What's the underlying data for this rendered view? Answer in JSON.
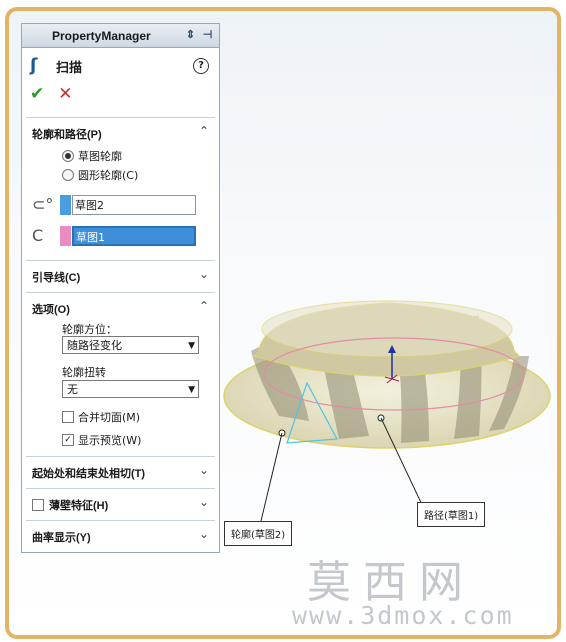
{
  "panel": {
    "title": "PropertyManager",
    "feature_title": "扫描",
    "feature_icon": "sweep-icon",
    "help_glyph": "?",
    "ok_glyph": "✔",
    "cancel_glyph": "✕"
  },
  "profile_path": {
    "header": "轮廓和路径(P)",
    "options": [
      {
        "label": "草图轮廓",
        "selected": true
      },
      {
        "label": "圆形轮廓(C)",
        "selected": false
      }
    ],
    "profile_value": "草图2",
    "profile_color": "#4a9ee0",
    "path_value": "草图1",
    "path_color": "#e98cc4"
  },
  "guides": {
    "header": "引导线(C)"
  },
  "options": {
    "header": "选项(O)",
    "orientation_label": "轮廓方位：",
    "orientation_value": "随路径变化",
    "twist_label": "轮廓扭转",
    "twist_value": "无",
    "merge_faces": {
      "label": "合并切面(M)",
      "checked": false
    },
    "show_preview": {
      "label": "显示预览(W)",
      "checked": true
    }
  },
  "tangency": {
    "header": "起始处和结束处相切(T)"
  },
  "thin_feature": {
    "label": "薄壁特征(H)",
    "checked": false
  },
  "curvature": {
    "header": "曲率显示(Y)"
  },
  "viewport": {
    "callout_profile": "轮廓(草图2)",
    "callout_path": "路径(草图1)",
    "watermark_cn": "莫西网",
    "watermark_url": "www.3dmox.com"
  },
  "colors": {
    "frame": "#e3b464",
    "selection_active": "#3c8fd8"
  }
}
